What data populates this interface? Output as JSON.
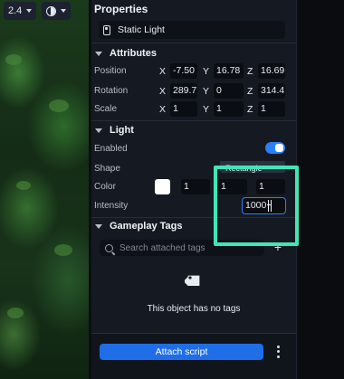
{
  "toolbar": {
    "zoom_value": "2.4"
  },
  "panel": {
    "title": "Properties",
    "object_name": "Static Light"
  },
  "attributes": {
    "header": "Attributes",
    "rows": [
      {
        "label": "Position",
        "x": "-7.50",
        "y": "16.78",
        "z": "16.69"
      },
      {
        "label": "Rotation",
        "x": "289.7",
        "y": "0",
        "z": "314.4"
      },
      {
        "label": "Scale",
        "x": "1",
        "y": "1",
        "z": "1"
      }
    ],
    "axis": {
      "x": "X",
      "y": "Y",
      "z": "Z"
    }
  },
  "light": {
    "header": "Light",
    "enabled_label": "Enabled",
    "enabled": true,
    "shape_label": "Shape",
    "shape_value": "Rectangle",
    "color_label": "Color",
    "color_swatch": "#ffffff",
    "color_values": [
      "1",
      "1",
      "1"
    ],
    "intensity_label": "Intensity",
    "intensity_value": "1000"
  },
  "gameplay_tags": {
    "header": "Gameplay Tags",
    "search_placeholder": "Search attached tags",
    "empty_text": "This object has no tags"
  },
  "footer": {
    "attach_label": "Attach script"
  },
  "colors": {
    "accent": "#1f6ee8",
    "highlight": "#41e6b6",
    "panel_bg": "#151a22"
  },
  "icons": [
    "chevron-down-icon",
    "globe-icon",
    "tag-icon",
    "search-icon",
    "plus-icon",
    "kebab-menu-icon",
    "text-cursor-icon"
  ]
}
